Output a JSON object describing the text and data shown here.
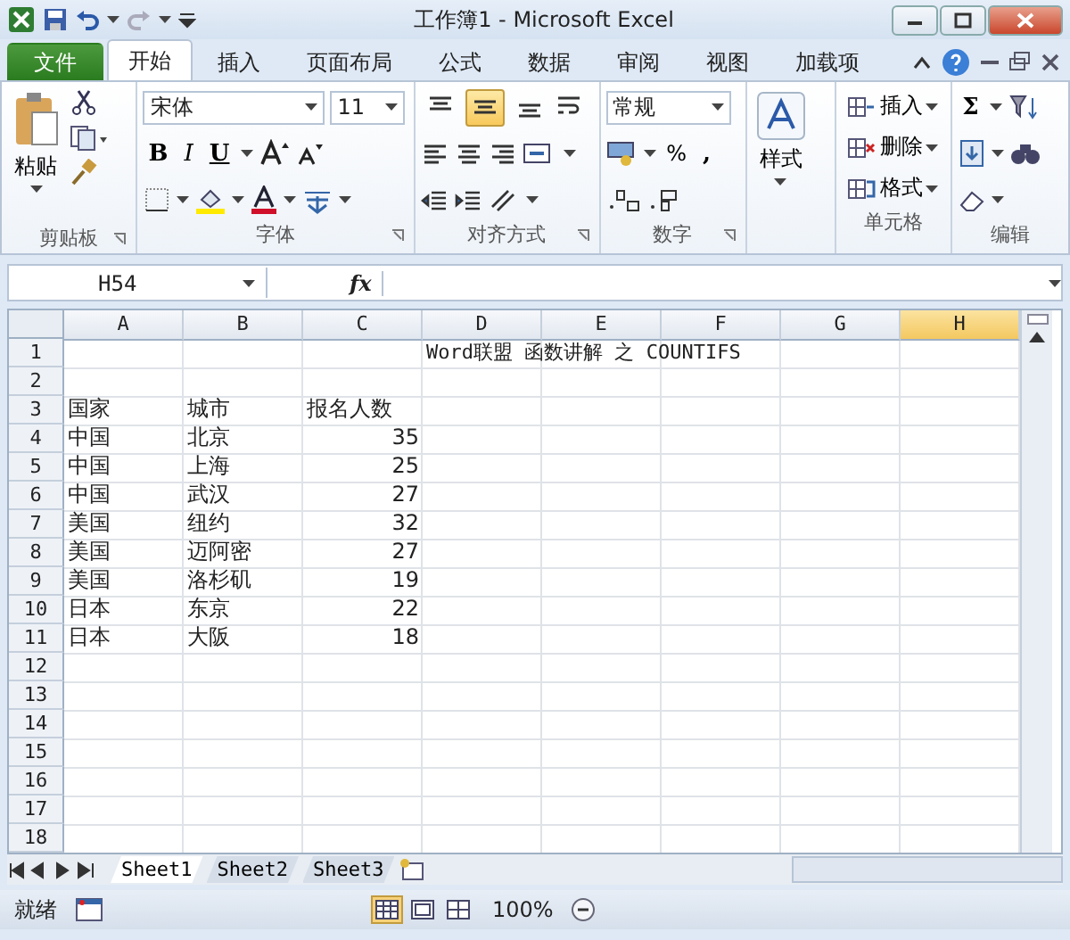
{
  "window": {
    "title": "工作簿1  -  Microsoft Excel"
  },
  "tabs": [
    {
      "label": "文件",
      "kind": "file",
      "selected": false
    },
    {
      "label": "开始",
      "kind": "tab",
      "selected": true
    },
    {
      "label": "插入",
      "kind": "tab",
      "selected": false
    },
    {
      "label": "页面布局",
      "kind": "tab",
      "selected": false
    },
    {
      "label": "公式",
      "kind": "tab",
      "selected": false
    },
    {
      "label": "数据",
      "kind": "tab",
      "selected": false
    },
    {
      "label": "审阅",
      "kind": "tab",
      "selected": false
    },
    {
      "label": "视图",
      "kind": "tab",
      "selected": false
    },
    {
      "label": "加载项",
      "kind": "tab",
      "selected": false
    }
  ],
  "ribbon": {
    "clipboard": {
      "label": "剪贴板",
      "paste": "粘贴"
    },
    "font": {
      "label": "字体",
      "family": "宋体",
      "size": "11",
      "bold": "B",
      "italic": "I",
      "underline": "U"
    },
    "alignment": {
      "label": "对齐方式",
      "buttons": [
        {
          "selected": false
        },
        {
          "selected": true
        },
        {
          "selected": false
        }
      ]
    },
    "number": {
      "label": "数字",
      "format": "常规",
      "percent": "%",
      "comma": ","
    },
    "styles": {
      "button": "样式"
    },
    "cells": {
      "label": "单元格",
      "buttons": [
        "插入",
        "删除",
        "格式"
      ]
    },
    "editing": {
      "label": "编辑",
      "sum": "Σ"
    }
  },
  "formula_bar": {
    "name_box": "H54",
    "fx": "fx"
  },
  "sheet": {
    "columns": [
      {
        "label": "A",
        "selected": false
      },
      {
        "label": "B",
        "selected": false
      },
      {
        "label": "C",
        "selected": false
      },
      {
        "label": "D",
        "selected": false
      },
      {
        "label": "E",
        "selected": false
      },
      {
        "label": "F",
        "selected": false
      },
      {
        "label": "G",
        "selected": false
      },
      {
        "label": "H",
        "selected": true
      }
    ],
    "rows": [
      {
        "header": "1",
        "D": {
          "text": "Word联盟 函数讲解 之  COUNTIFS",
          "kind": "text"
        }
      },
      {
        "header": "2"
      },
      {
        "header": "3",
        "A": {
          "text": "国家",
          "kind": "text"
        },
        "B": {
          "text": "城市",
          "kind": "text"
        },
        "C": {
          "text": "报名人数",
          "kind": "text"
        }
      },
      {
        "header": "4",
        "A": {
          "text": "中国",
          "kind": "text"
        },
        "B": {
          "text": "北京",
          "kind": "text"
        },
        "C": {
          "text": "35",
          "kind": "number"
        }
      },
      {
        "header": "5",
        "A": {
          "text": "中国",
          "kind": "text"
        },
        "B": {
          "text": "上海",
          "kind": "text"
        },
        "C": {
          "text": "25",
          "kind": "number"
        }
      },
      {
        "header": "6",
        "A": {
          "text": "中国",
          "kind": "text"
        },
        "B": {
          "text": "武汉",
          "kind": "text"
        },
        "C": {
          "text": "27",
          "kind": "number"
        }
      },
      {
        "header": "7",
        "A": {
          "text": "美国",
          "kind": "text"
        },
        "B": {
          "text": "纽约",
          "kind": "text"
        },
        "C": {
          "text": "32",
          "kind": "number"
        }
      },
      {
        "header": "8",
        "A": {
          "text": "美国",
          "kind": "text"
        },
        "B": {
          "text": "迈阿密",
          "kind": "text"
        },
        "C": {
          "text": "27",
          "kind": "number"
        }
      },
      {
        "header": "9",
        "A": {
          "text": "美国",
          "kind": "text"
        },
        "B": {
          "text": "洛杉矶",
          "kind": "text"
        },
        "C": {
          "text": "19",
          "kind": "number"
        }
      },
      {
        "header": "10",
        "A": {
          "text": "日本",
          "kind": "text"
        },
        "B": {
          "text": "东京",
          "kind": "text"
        },
        "C": {
          "text": "22",
          "kind": "number"
        }
      },
      {
        "header": "11",
        "A": {
          "text": "日本",
          "kind": "text"
        },
        "B": {
          "text": "大阪",
          "kind": "text"
        },
        "C": {
          "text": "18",
          "kind": "number"
        }
      },
      {
        "header": "12"
      },
      {
        "header": "13"
      },
      {
        "header": "14"
      },
      {
        "header": "15"
      },
      {
        "header": "16"
      },
      {
        "header": "17"
      },
      {
        "header": "18"
      }
    ]
  },
  "sheet_tabs": [
    {
      "label": "Sheet1",
      "selected": true
    },
    {
      "label": "Sheet2",
      "selected": false
    },
    {
      "label": "Sheet3",
      "selected": false
    }
  ],
  "status_bar": {
    "status": "就绪",
    "views": [
      {
        "selected": true
      },
      {
        "selected": false
      },
      {
        "selected": false
      }
    ],
    "zoom": "100%"
  }
}
